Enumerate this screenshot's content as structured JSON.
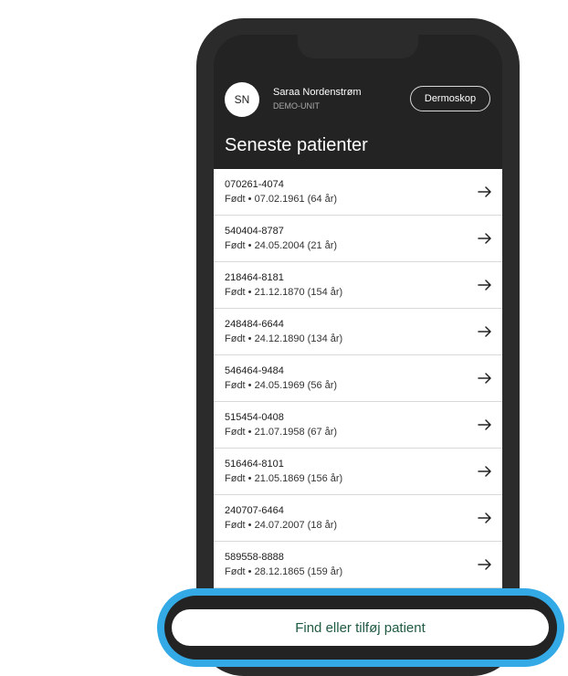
{
  "user": {
    "initials": "SN",
    "name": "Saraa Nordenstrøm",
    "unit": "DEMO-UNIT"
  },
  "header": {
    "dermoscope_label": "Dermoskop",
    "section_title": "Seneste patienter"
  },
  "patients": [
    {
      "id": "070261-4074",
      "born": "Født • 07.02.1961 (64 år)"
    },
    {
      "id": "540404-8787",
      "born": "Født • 24.05.2004 (21 år)"
    },
    {
      "id": "218464-8181",
      "born": "Født • 21.12.1870 (154 år)"
    },
    {
      "id": "248484-6644",
      "born": "Født • 24.12.1890 (134 år)"
    },
    {
      "id": "546464-9484",
      "born": "Født • 24.05.1969 (56 år)"
    },
    {
      "id": "515454-0408",
      "born": "Født • 21.07.1958 (67 år)"
    },
    {
      "id": "516464-8101",
      "born": "Født • 21.05.1869 (156 år)"
    },
    {
      "id": "240707-6464",
      "born": "Født • 24.07.2007 (18 år)"
    },
    {
      "id": "589558-8888",
      "born": "Født • 28.12.1865 (159 år)"
    }
  ],
  "footer": {
    "find_label": "Find eller tilføj patient"
  },
  "icons": {
    "row_arrow": "arrow-right-icon"
  },
  "colors": {
    "highlight": "#33a9e6",
    "button_text": "#1f5b43",
    "screen_bg": "#232323"
  }
}
